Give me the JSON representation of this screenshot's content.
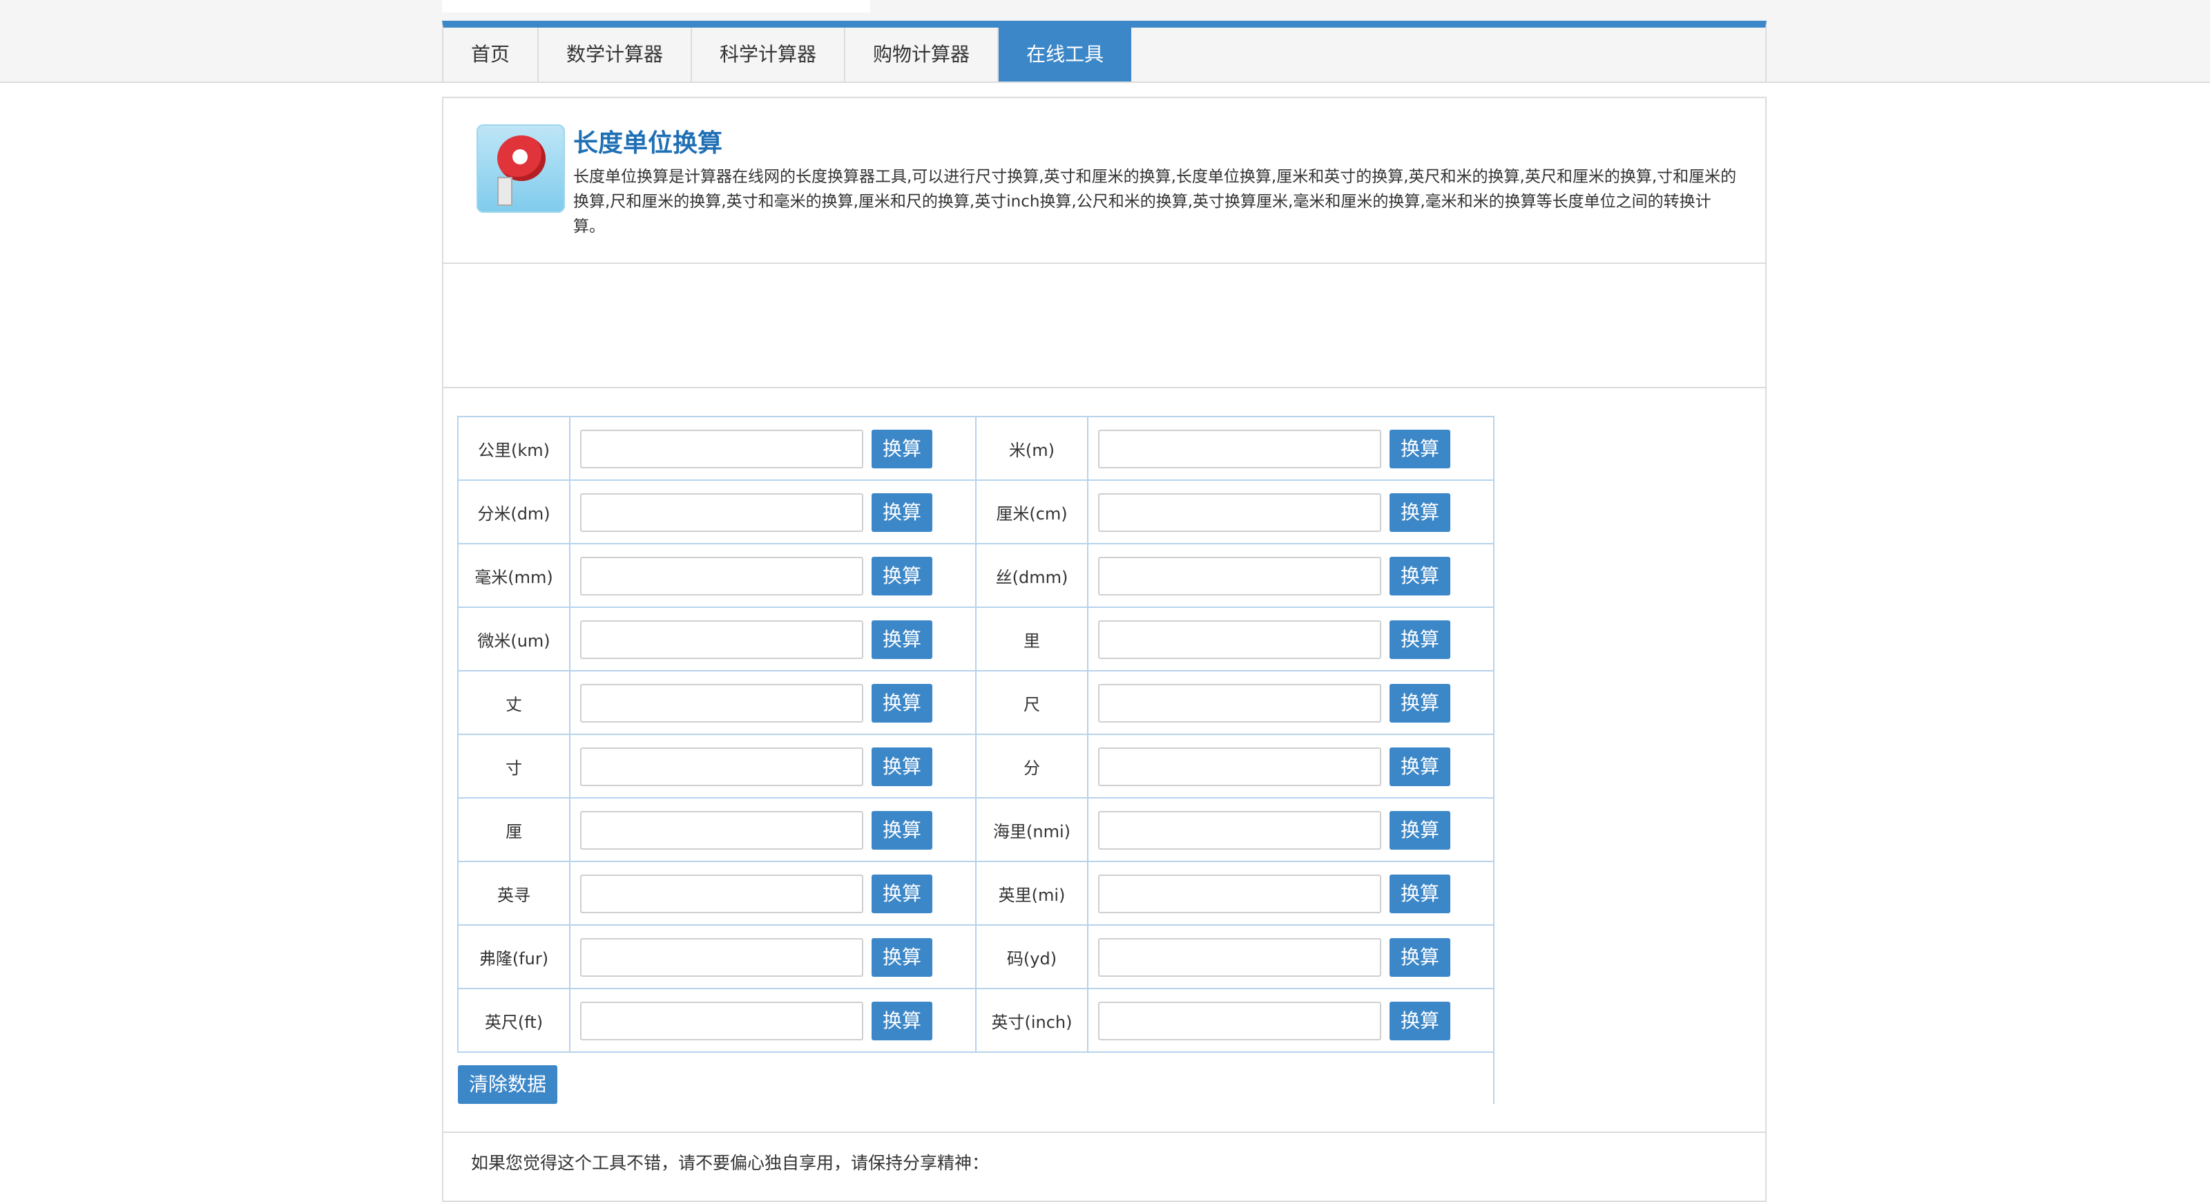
{
  "nav": {
    "items": [
      {
        "label": "首页",
        "active": false
      },
      {
        "label": "数学计算器",
        "active": false
      },
      {
        "label": "科学计算器",
        "active": false
      },
      {
        "label": "购物计算器",
        "active": false
      },
      {
        "label": "在线工具",
        "active": true
      }
    ]
  },
  "intro": {
    "title": "长度单位换算",
    "description": "长度单位换算是计算器在线网的长度换算器工具,可以进行尺寸换算,英寸和厘米的换算,长度单位换算,厘米和英寸的换算,英尺和米的换算,英尺和厘米的换算,寸和厘米的换算,尺和厘米的换算,英寸和毫米的换算,厘米和尺的换算,英寸inch换算,公尺和米的换算,英寸换算厘米,毫米和厘米的换算,毫米和米的换算等长度单位之间的转换计算。",
    "icon": "tape-measure-icon"
  },
  "converter": {
    "button_label": "换算",
    "rows": [
      [
        {
          "unit": "公里(km)",
          "value": ""
        },
        {
          "unit": "米(m)",
          "value": ""
        }
      ],
      [
        {
          "unit": "分米(dm)",
          "value": ""
        },
        {
          "unit": "厘米(cm)",
          "value": ""
        }
      ],
      [
        {
          "unit": "毫米(mm)",
          "value": ""
        },
        {
          "unit": "丝(dmm)",
          "value": ""
        }
      ],
      [
        {
          "unit": "微米(um)",
          "value": ""
        },
        {
          "unit": "里",
          "value": ""
        }
      ],
      [
        {
          "unit": "丈",
          "value": ""
        },
        {
          "unit": "尺",
          "value": ""
        }
      ],
      [
        {
          "unit": "寸",
          "value": ""
        },
        {
          "unit": "分",
          "value": ""
        }
      ],
      [
        {
          "unit": "厘",
          "value": ""
        },
        {
          "unit": "海里(nmi)",
          "value": ""
        }
      ],
      [
        {
          "unit": "英寻",
          "value": ""
        },
        {
          "unit": "英里(mi)",
          "value": ""
        }
      ],
      [
        {
          "unit": "弗隆(fur)",
          "value": ""
        },
        {
          "unit": "码(yd)",
          "value": ""
        }
      ],
      [
        {
          "unit": "英尺(ft)",
          "value": ""
        },
        {
          "unit": "英寸(inch)",
          "value": ""
        }
      ]
    ],
    "clear_label": "清除数据"
  },
  "footer": {
    "share_text": "如果您觉得这个工具不错，请不要偏心独自享用，请保持分享精神："
  },
  "colors": {
    "accent": "#3c87c8",
    "title": "#1f6fb5",
    "table_border": "#b7d3ec"
  }
}
